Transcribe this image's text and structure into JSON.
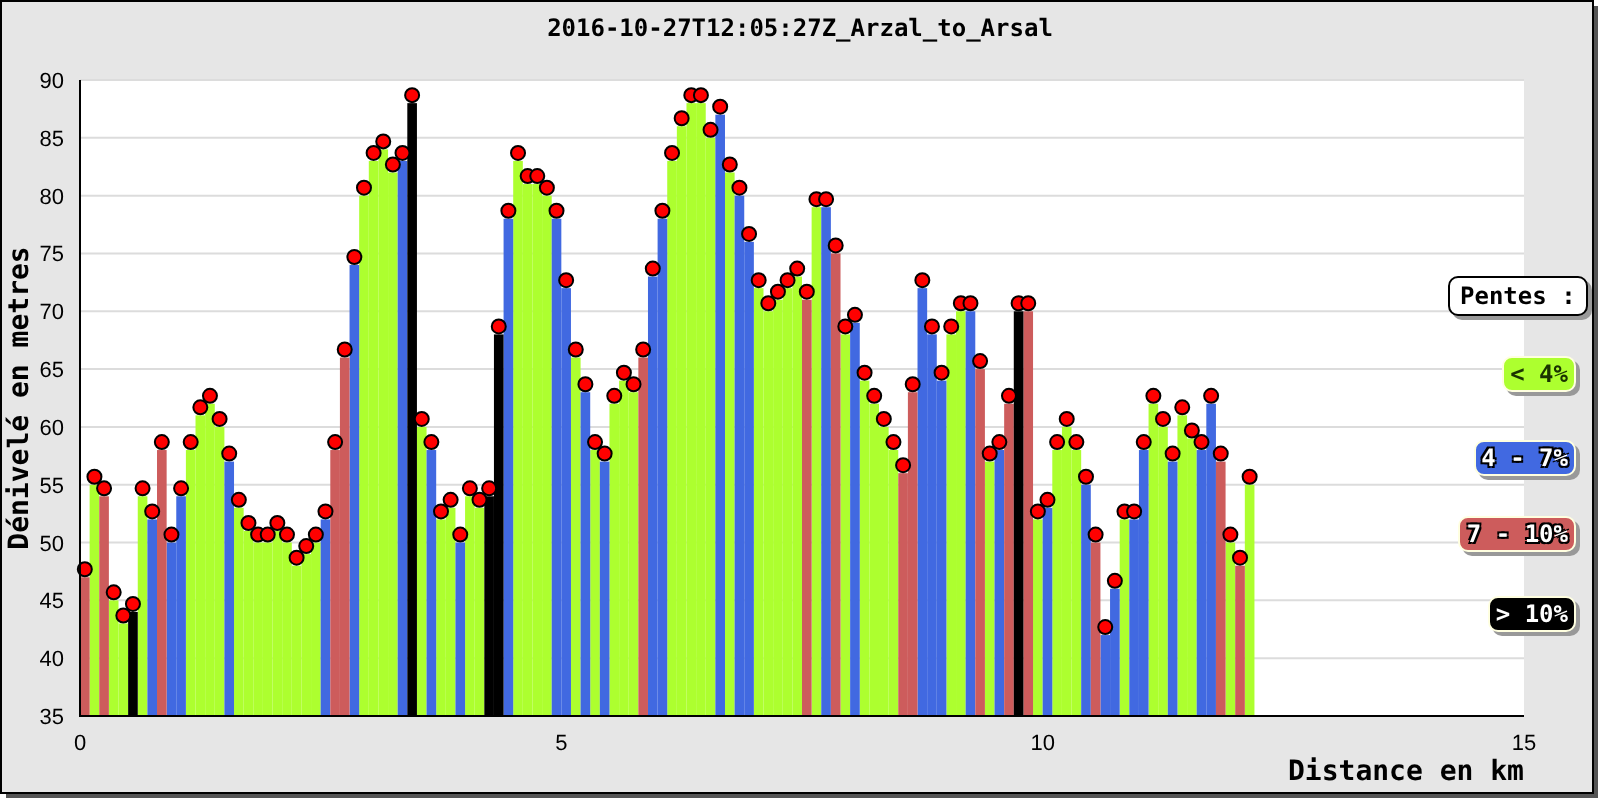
{
  "chart": {
    "title": "2016-10-27T12:05:27Z_Arzal_to_Arsal",
    "legend_title": "Pentes :",
    "chart_data": {
      "type": "bar",
      "xlabel": "Distance en km",
      "ylabel": "Dénivelé en metres",
      "grid": true,
      "x": [
        0,
        0.1,
        0.2,
        0.3,
        0.4,
        0.5,
        0.6,
        0.7,
        0.8,
        0.9,
        1,
        1.1,
        1.2,
        1.3,
        1.4,
        1.5,
        1.6,
        1.7,
        1.8,
        1.9,
        2,
        2.1,
        2.2,
        2.3,
        2.4,
        2.5,
        2.6,
        2.7,
        2.8,
        2.9,
        3,
        3.1,
        3.2,
        3.3,
        3.4,
        3.5,
        3.6,
        3.7,
        3.8,
        3.9,
        4,
        4.1,
        4.2,
        4.3,
        4.4,
        4.5,
        4.6,
        4.7,
        4.8,
        4.9,
        5,
        5.1,
        5.2,
        5.3,
        5.4,
        5.5,
        5.6,
        5.7,
        5.8,
        5.9,
        6,
        6.1,
        6.2,
        6.3,
        6.4,
        6.5,
        6.6,
        6.7,
        6.8,
        6.9,
        7,
        7.1,
        7.2,
        7.3,
        7.4,
        7.5,
        7.6,
        7.7,
        7.8,
        7.9,
        8,
        8.1,
        8.2,
        8.3,
        8.4,
        8.5,
        8.6,
        8.7,
        8.8,
        8.9,
        9,
        9.1,
        9.2,
        9.3,
        9.4,
        9.5,
        9.6,
        9.7,
        9.8,
        9.9,
        10,
        10.1,
        10.2,
        10.3,
        10.4,
        10.5,
        10.6,
        10.7,
        10.8,
        10.9,
        11,
        11.1,
        11.2,
        11.3,
        11.4,
        11.5,
        11.6,
        11.7,
        11.8,
        11.9,
        12,
        12.1
      ],
      "series": [
        {
          "name": "< 4%",
          "color": "#adff2f",
          "values": [
            null,
            55,
            null,
            45,
            43,
            null,
            54,
            null,
            null,
            null,
            null,
            58,
            61,
            62,
            60,
            null,
            53,
            51,
            50,
            50,
            51,
            50,
            48,
            49,
            50,
            null,
            null,
            null,
            null,
            80,
            83,
            84,
            82,
            null,
            null,
            60,
            null,
            52,
            53,
            null,
            54,
            53,
            null,
            null,
            null,
            83,
            81,
            81,
            80,
            null,
            null,
            66,
            null,
            58,
            null,
            62,
            64,
            63,
            null,
            null,
            null,
            83,
            86,
            88,
            88,
            85,
            null,
            82,
            null,
            null,
            72,
            70,
            71,
            72,
            73,
            null,
            79,
            null,
            null,
            68,
            null,
            64,
            62,
            60,
            58,
            null,
            null,
            null,
            null,
            null,
            68,
            70,
            null,
            null,
            57,
            null,
            null,
            null,
            null,
            52,
            null,
            58,
            60,
            58,
            null,
            null,
            null,
            null,
            52,
            null,
            null,
            62,
            60,
            null,
            61,
            59,
            null,
            null,
            null,
            50,
            null,
            55
          ]
        },
        {
          "name": "4 - 7%",
          "color": "#4169e1",
          "values": [
            null,
            null,
            null,
            null,
            null,
            null,
            null,
            52,
            null,
            50,
            54,
            null,
            null,
            null,
            null,
            57,
            null,
            null,
            null,
            null,
            null,
            null,
            null,
            null,
            null,
            52,
            null,
            null,
            74,
            null,
            null,
            null,
            null,
            83,
            null,
            null,
            58,
            null,
            null,
            50,
            null,
            null,
            null,
            null,
            78,
            null,
            null,
            null,
            null,
            78,
            72,
            null,
            63,
            null,
            57,
            null,
            null,
            null,
            null,
            73,
            78,
            null,
            null,
            null,
            null,
            null,
            87,
            null,
            80,
            76,
            null,
            null,
            null,
            null,
            null,
            null,
            null,
            79,
            null,
            null,
            69,
            null,
            null,
            null,
            null,
            null,
            null,
            72,
            68,
            64,
            null,
            null,
            70,
            null,
            null,
            58,
            null,
            null,
            null,
            null,
            53,
            null,
            null,
            null,
            55,
            null,
            42,
            46,
            null,
            52,
            58,
            null,
            null,
            57,
            null,
            null,
            58,
            62,
            null,
            null,
            null,
            null
          ]
        },
        {
          "name": "7 - 10%",
          "color": "#cd5c5c",
          "values": [
            47,
            null,
            54,
            null,
            null,
            null,
            null,
            null,
            58,
            null,
            null,
            null,
            null,
            null,
            null,
            null,
            null,
            null,
            null,
            null,
            null,
            null,
            null,
            null,
            null,
            null,
            58,
            66,
            null,
            null,
            null,
            null,
            null,
            null,
            null,
            null,
            null,
            null,
            null,
            null,
            null,
            null,
            null,
            null,
            null,
            null,
            null,
            null,
            null,
            null,
            null,
            null,
            null,
            null,
            null,
            null,
            null,
            null,
            66,
            null,
            null,
            null,
            null,
            null,
            null,
            null,
            null,
            null,
            null,
            null,
            null,
            null,
            null,
            null,
            null,
            71,
            null,
            null,
            75,
            null,
            null,
            null,
            null,
            null,
            null,
            56,
            63,
            null,
            null,
            null,
            null,
            null,
            null,
            65,
            null,
            null,
            62,
            null,
            70,
            null,
            null,
            null,
            null,
            null,
            null,
            50,
            null,
            null,
            null,
            null,
            null,
            null,
            null,
            null,
            null,
            null,
            null,
            null,
            57,
            null,
            48,
            null
          ]
        },
        {
          "name": "> 10%",
          "color": "#000000",
          "values": [
            null,
            null,
            null,
            null,
            null,
            44,
            null,
            null,
            null,
            null,
            null,
            null,
            null,
            null,
            null,
            null,
            null,
            null,
            null,
            null,
            null,
            null,
            null,
            null,
            null,
            null,
            null,
            null,
            null,
            null,
            null,
            null,
            null,
            null,
            88,
            null,
            null,
            null,
            null,
            null,
            null,
            null,
            54,
            68,
            null,
            null,
            null,
            null,
            null,
            null,
            null,
            null,
            null,
            null,
            null,
            null,
            null,
            null,
            null,
            null,
            null,
            null,
            null,
            null,
            null,
            null,
            null,
            null,
            null,
            null,
            null,
            null,
            null,
            null,
            null,
            null,
            null,
            null,
            null,
            null,
            null,
            null,
            null,
            null,
            null,
            null,
            null,
            null,
            null,
            null,
            null,
            null,
            null,
            null,
            null,
            null,
            null,
            70,
            null,
            null,
            null,
            null,
            null,
            null,
            null,
            null,
            null,
            null,
            null,
            null,
            null,
            null,
            null,
            null,
            null,
            null,
            null,
            null,
            null,
            null,
            null,
            null
          ]
        }
      ],
      "xlim": [
        0,
        15
      ],
      "ylim": [
        35,
        90
      ],
      "xticks": [
        0,
        5,
        10,
        15
      ],
      "yticks": [
        35,
        40,
        45,
        50,
        55,
        60,
        65,
        70,
        75,
        80,
        85,
        90
      ]
    }
  }
}
